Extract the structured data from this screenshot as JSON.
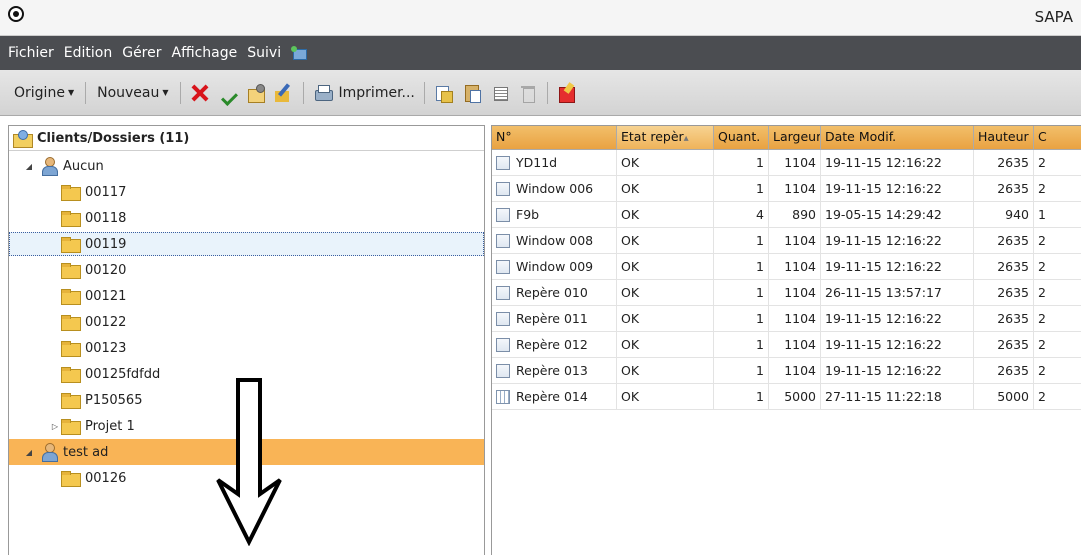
{
  "window": {
    "title": "SAPA"
  },
  "menu": [
    "Fichier",
    "Edition",
    "Gérer",
    "Affichage",
    "Suivi"
  ],
  "toolbar": {
    "origine": "Origine",
    "nouveau": "Nouveau",
    "imprimer": "Imprimer..."
  },
  "tree": {
    "header": "Clients/Dossiers (11)",
    "nodes": [
      {
        "label": "Aucun",
        "type": "user",
        "level": 0,
        "expander": "◢"
      },
      {
        "label": "00117",
        "type": "folder",
        "level": 1
      },
      {
        "label": "00118",
        "type": "folder",
        "level": 1
      },
      {
        "label": "00119",
        "type": "folder",
        "level": 1,
        "selected": true
      },
      {
        "label": "00120",
        "type": "folder",
        "level": 1
      },
      {
        "label": "00121",
        "type": "folder",
        "level": 1
      },
      {
        "label": "00122",
        "type": "folder",
        "level": 1
      },
      {
        "label": "00123",
        "type": "folder",
        "level": 1
      },
      {
        "label": "00125fdfdd",
        "type": "folder",
        "level": 1
      },
      {
        "label": "P150565",
        "type": "folder",
        "level": 1
      },
      {
        "label": "Projet 1",
        "type": "folder",
        "level": 1,
        "expander": "▷"
      },
      {
        "label": "test ad",
        "type": "user",
        "level": 0,
        "expander": "◢",
        "highlight": true
      },
      {
        "label": "00126",
        "type": "folder",
        "level": 1
      }
    ]
  },
  "grid": {
    "columns": [
      "N°",
      "Etat repèr",
      "Quant.",
      "Largeur",
      "Date Modif.",
      "Hauteur",
      "C"
    ],
    "rows": [
      {
        "n": "YD11d",
        "etat": "OK",
        "quant": "1",
        "largeur": "1104",
        "date": "19-11-15 12:16:22",
        "hauteur": "2635",
        "c": "2"
      },
      {
        "n": "Window 006",
        "etat": "OK",
        "quant": "1",
        "largeur": "1104",
        "date": "19-11-15 12:16:22",
        "hauteur": "2635",
        "c": "2"
      },
      {
        "n": "F9b",
        "etat": "OK",
        "quant": "4",
        "largeur": "890",
        "date": "19-05-15 14:29:42",
        "hauteur": "940",
        "c": "1"
      },
      {
        "n": "Window 008",
        "etat": "OK",
        "quant": "1",
        "largeur": "1104",
        "date": "19-11-15 12:16:22",
        "hauteur": "2635",
        "c": "2"
      },
      {
        "n": "Window 009",
        "etat": "OK",
        "quant": "1",
        "largeur": "1104",
        "date": "19-11-15 12:16:22",
        "hauteur": "2635",
        "c": "2"
      },
      {
        "n": "Repère 010",
        "etat": "OK",
        "quant": "1",
        "largeur": "1104",
        "date": "26-11-15 13:57:17",
        "hauteur": "2635",
        "c": "2"
      },
      {
        "n": "Repère 011",
        "etat": "OK",
        "quant": "1",
        "largeur": "1104",
        "date": "19-11-15 12:16:22",
        "hauteur": "2635",
        "c": "2"
      },
      {
        "n": "Repère 012",
        "etat": "OK",
        "quant": "1",
        "largeur": "1104",
        "date": "19-11-15 12:16:22",
        "hauteur": "2635",
        "c": "2"
      },
      {
        "n": "Repère 013",
        "etat": "OK",
        "quant": "1",
        "largeur": "1104",
        "date": "19-11-15 12:16:22",
        "hauteur": "2635",
        "c": "2"
      },
      {
        "n": "Repère 014",
        "etat": "OK",
        "quant": "1",
        "largeur": "5000",
        "date": "27-11-15 11:22:18",
        "hauteur": "5000",
        "c": "2",
        "grid_icon": true
      }
    ]
  }
}
